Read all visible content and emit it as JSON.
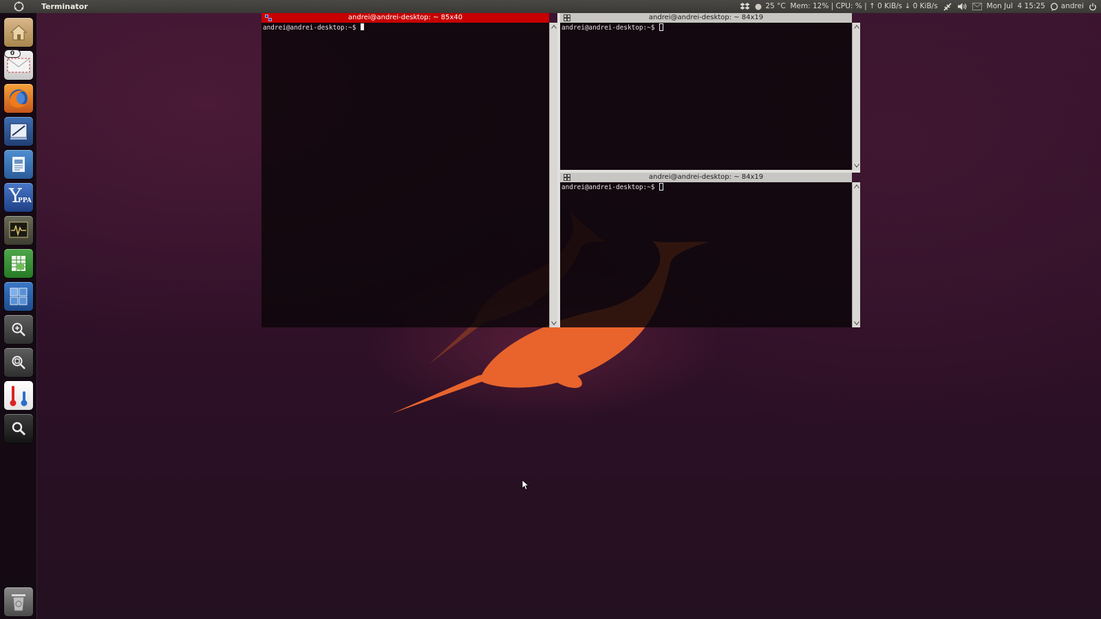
{
  "top_panel": {
    "app_title": "Terminator",
    "temperature": "25 °C",
    "mem": "Mem: 12%",
    "cpu": "CPU: %",
    "separator": "|",
    "net_up": "↑ 0 KiB/s",
    "net_down": "↓ 0 KiB/s",
    "clock": "Mon Jul  4 15:25",
    "user": "andrei"
  },
  "launcher": {
    "items": [
      {
        "name": "home-folder",
        "icon": "home-folder-icon"
      },
      {
        "name": "mail",
        "icon": "mail-icon",
        "badge": "0"
      },
      {
        "name": "firefox",
        "icon": "firefox-icon"
      },
      {
        "name": "text-editor",
        "icon": "text-editor-icon"
      },
      {
        "name": "document-viewer",
        "icon": "document-viewer-icon"
      },
      {
        "name": "y-ppa-manager",
        "icon": "y-ppa-icon",
        "label": "Y",
        "sub": "PPA"
      },
      {
        "name": "system-monitor",
        "icon": "system-monitor-icon"
      },
      {
        "name": "spreadsheet",
        "icon": "spreadsheet-icon"
      },
      {
        "name": "workspace-switcher",
        "icon": "workspace-switcher-icon"
      },
      {
        "name": "zoom-in",
        "icon": "zoom-in-icon"
      },
      {
        "name": "zoom-fit",
        "icon": "zoom-fit-icon"
      },
      {
        "name": "temperature-monitor",
        "icon": "thermometer-icon"
      },
      {
        "name": "search",
        "icon": "search-icon"
      },
      {
        "name": "trash",
        "icon": "trash-icon"
      }
    ]
  },
  "terminator": {
    "panes": [
      {
        "title": "andrei@andrei-desktop: ~ 85x40",
        "prompt": "andrei@andrei-desktop:~$ ",
        "active": true
      },
      {
        "title": "andrei@andrei-desktop: ~ 84x19",
        "prompt": "andrei@andrei-desktop:~$ ",
        "active": false
      },
      {
        "title": "andrei@andrei-desktop: ~ 84x19",
        "prompt": "andrei@andrei-desktop:~$ ",
        "active": false
      }
    ]
  },
  "colors": {
    "active_title": "#c70000",
    "inactive_title": "#c8c6c2",
    "wallpaper": "#2e1027",
    "narwhal": "#e8642c"
  }
}
